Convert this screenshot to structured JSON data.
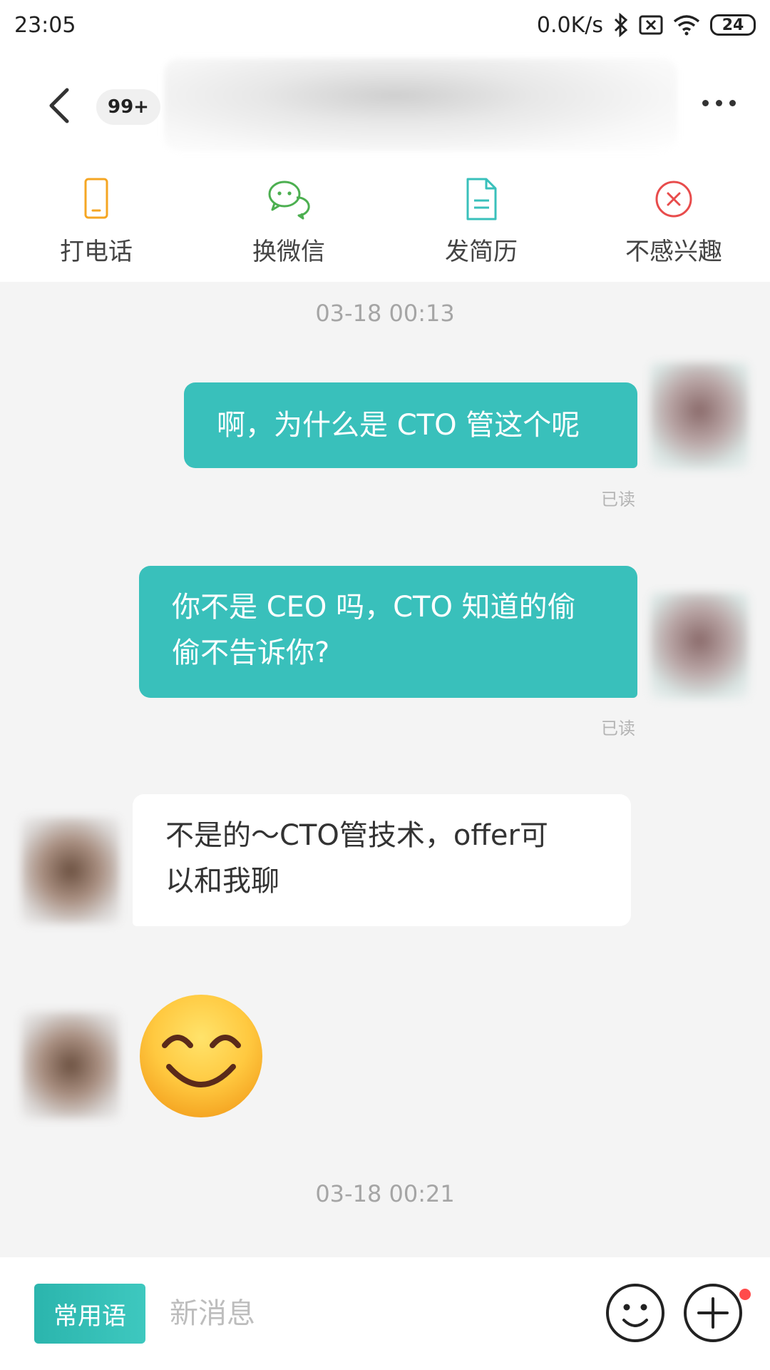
{
  "status_bar": {
    "time": "23:05",
    "network_speed": "0.0K/s",
    "battery": "24"
  },
  "header": {
    "unread_count": "99+",
    "back_icon": "chevron-left-icon",
    "more_icon": "more-horizontal-icon"
  },
  "actions": [
    {
      "label": "打电话",
      "icon": "phone-icon",
      "color": "#f5a623"
    },
    {
      "label": "换微信",
      "icon": "wechat-icon",
      "color": "#4caf50"
    },
    {
      "label": "发简历",
      "icon": "document-icon",
      "color": "#39c0bb"
    },
    {
      "label": "不感兴趣",
      "icon": "close-circle-icon",
      "color": "#e84c4c"
    }
  ],
  "messages": {
    "time_1": "03-18 00:13",
    "msg_1": "啊，为什么是 CTO 管这个呢",
    "msg_1_status": "已读",
    "msg_2_line1": "你不是 CEO 吗，CTO 知道的偷",
    "msg_2_line2": "偷不告诉你?",
    "msg_2_status": "已读",
    "msg_3_line1": "不是的～CTO管技术，offer可",
    "msg_3_line2": "以和我聊",
    "msg_4_emoji": "smiling-face-emoji",
    "time_2": "03-18 00:21"
  },
  "input_bar": {
    "quick_reply_label": "常用语",
    "placeholder": "新消息",
    "emoji_icon": "smiley-icon",
    "plus_icon": "plus-circle-icon"
  },
  "colors": {
    "accent": "#39c0bb",
    "background": "#f4f4f4",
    "notification_dot": "#ff4b4b"
  }
}
